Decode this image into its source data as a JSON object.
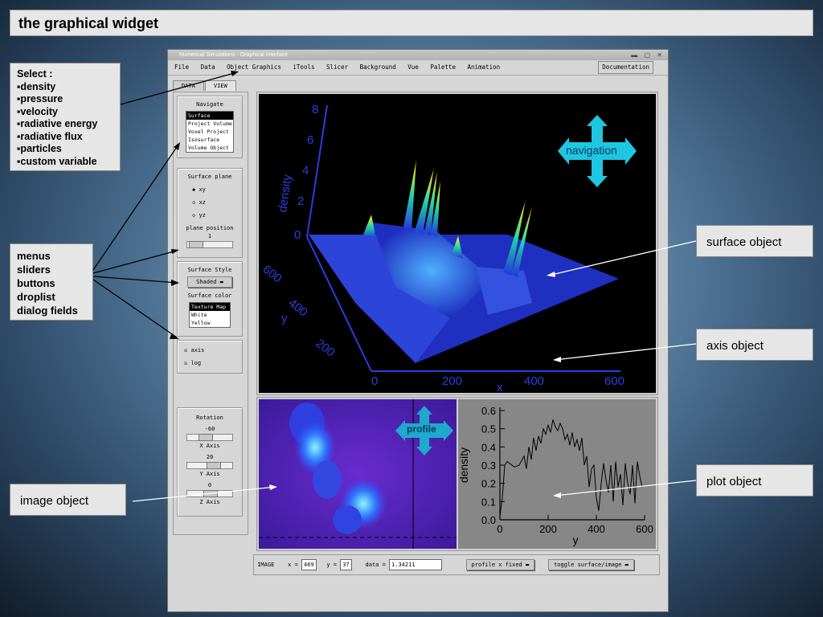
{
  "slide_title": "the graphical widget",
  "callouts": {
    "select_heading": "Select :",
    "select_items": [
      "▪density",
      "▪pressure",
      "▪velocity",
      "▪radiative energy",
      "▪radiative flux",
      "▪particles",
      "▪custom variable"
    ],
    "widgets": [
      "menus",
      "sliders",
      "buttons",
      "droplist",
      "dialog fields"
    ],
    "image_object": "image object",
    "surface_object": "surface object",
    "axis_object": "axis object",
    "plot_object": "plot object"
  },
  "window": {
    "title": "Numerical Simulations - Graphical Interface",
    "controls": "▬ ▢ ✕",
    "menu": [
      "File",
      "Data",
      "Object Graphics",
      "iTools",
      "Slicer",
      "Background",
      "Vue",
      "Palette",
      "Animation"
    ],
    "documentation": "Documentation",
    "tabs": [
      "DATA",
      "VIEW"
    ]
  },
  "navigate": {
    "title": "Navigate",
    "items": [
      "Surface",
      "Project Volume",
      "Voxel Project",
      "Isosurface",
      "Volume Object"
    ],
    "selected": 0
  },
  "surface_plane": {
    "title": "Surface plane",
    "options": [
      "xy",
      "xz",
      "yz"
    ],
    "position_label": "plane position",
    "position_value": "1"
  },
  "surface_style": {
    "title": "Surface Style",
    "style_value": "Shaded",
    "color_label": "Surface color",
    "colors": [
      "Texture Map",
      "White",
      "Yellow"
    ],
    "selected": 0
  },
  "checks": [
    "axis",
    "log"
  ],
  "rotation": {
    "title": "Rotation",
    "x_value": "-60",
    "x_label": "X Axis",
    "y_value": "20",
    "y_label": "Y Axis",
    "z_value": "0",
    "z_label": "Z Axis"
  },
  "bottom": {
    "mode": "IMAGE",
    "x_label": "x =",
    "x_value": "469",
    "y_label": "y =",
    "y_value": "37",
    "data_label": "data =",
    "data_value": "1.34211",
    "profile_button": "profile x fixed",
    "toggle_button": "toggle surface/image"
  },
  "surface_axes": {
    "z_label": "density",
    "z_ticks": [
      "0",
      "2",
      "4",
      "6",
      "8"
    ],
    "y_label": "y",
    "y_ticks": [
      "200",
      "400",
      "600"
    ],
    "x_label": "x",
    "x_ticks": [
      "0",
      "200",
      "400",
      "600"
    ]
  },
  "nav_labels": {
    "navigation": "navigation",
    "profile": "profile"
  },
  "colors": {
    "accent": "#1fc6e0",
    "surface_blue": "#2a3fd6",
    "plot_bg": "#878787"
  },
  "chart_data": {
    "type": "line",
    "xlabel": "y",
    "ylabel": "density",
    "xlim": [
      0,
      600
    ],
    "ylim": [
      0.0,
      0.6
    ],
    "x_ticks": [
      "0",
      "200",
      "400",
      "600"
    ],
    "y_ticks": [
      "0.0",
      "0.1",
      "0.2",
      "0.3",
      "0.4",
      "0.5",
      "0.6"
    ],
    "series": [
      {
        "x": [
          0,
          10,
          20,
          30,
          40,
          60,
          80,
          100,
          110,
          120,
          130,
          140,
          150,
          160,
          170,
          180,
          190,
          200,
          210,
          220,
          230,
          240,
          250,
          260,
          270,
          280,
          290,
          300,
          310,
          320,
          330,
          340,
          350,
          360,
          370,
          380,
          390,
          400,
          410,
          420,
          430,
          440,
          450,
          460,
          470,
          480,
          490,
          500,
          510,
          520,
          530,
          540,
          550,
          560,
          570,
          580,
          590
        ],
        "y": [
          0.02,
          0.12,
          0.3,
          0.32,
          0.31,
          0.29,
          0.3,
          0.35,
          0.28,
          0.4,
          0.33,
          0.45,
          0.38,
          0.46,
          0.42,
          0.5,
          0.47,
          0.52,
          0.48,
          0.55,
          0.51,
          0.49,
          0.53,
          0.5,
          0.44,
          0.47,
          0.41,
          0.48,
          0.4,
          0.44,
          0.38,
          0.45,
          0.3,
          0.35,
          0.18,
          0.28,
          0.3,
          0.12,
          0.05,
          0.2,
          0.31,
          0.22,
          0.15,
          0.3,
          0.1,
          0.32,
          0.18,
          0.25,
          0.08,
          0.31,
          0.2,
          0.14,
          0.3,
          0.09,
          0.32,
          0.24,
          0.18
        ]
      }
    ]
  }
}
